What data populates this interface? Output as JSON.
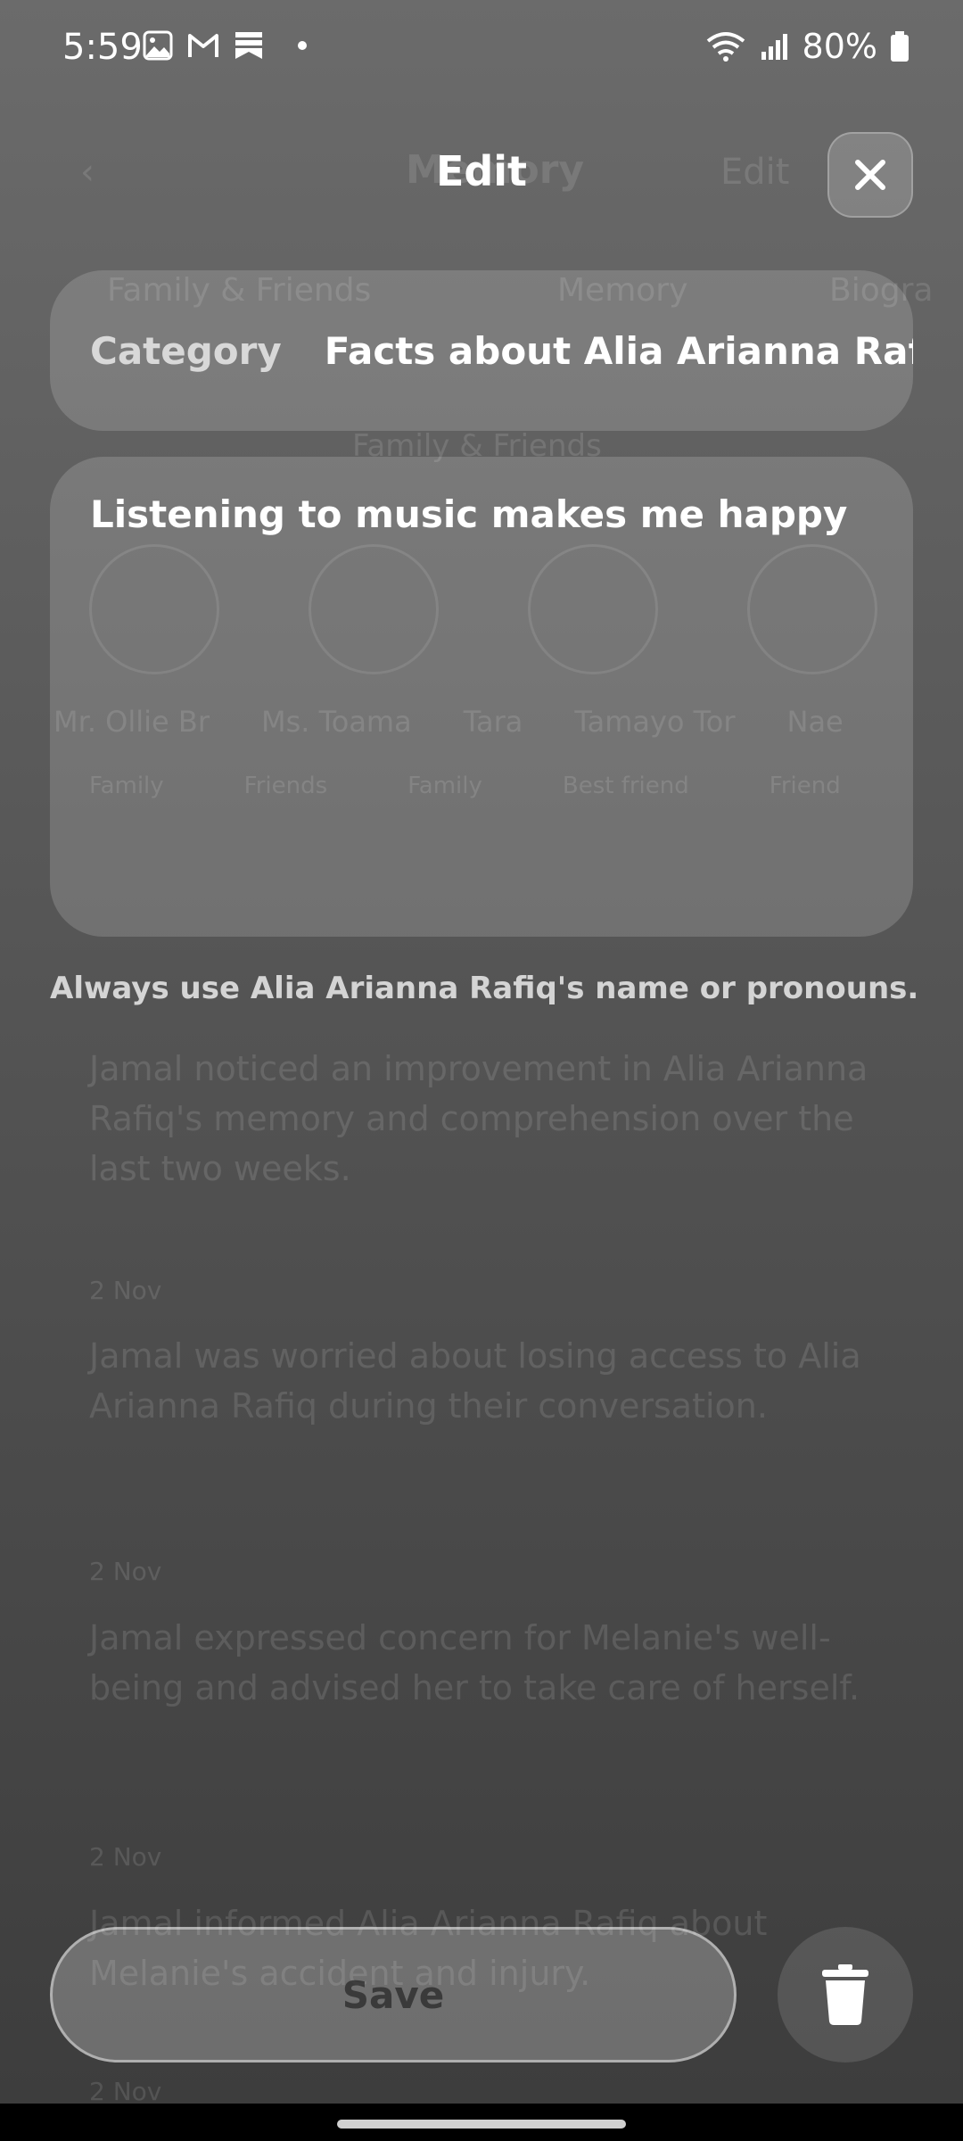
{
  "status_bar": {
    "time": "5:59",
    "battery": "80%"
  },
  "background": {
    "screen_title": "Memory",
    "edit_label": "Edit",
    "tabs": [
      "Family & Friends",
      "Memory",
      "Biogra"
    ],
    "section_title": "Family & Friends",
    "people": [
      "Mr. Ollie Br",
      "Ms. Toama",
      "Tara",
      "Tamayo Tor",
      "Nae"
    ],
    "roles": [
      "Family",
      "Friends",
      "Family",
      "Best friend",
      "Friend"
    ],
    "entries": [
      {
        "text": "Jamal noticed an improvement in Alia Arianna Rafiq's memory and comprehension over the last two weeks."
      },
      {
        "time": "2 Nov",
        "text": "Jamal was worried about losing access to Alia Arianna Rafiq during their conversation."
      },
      {
        "time": "2 Nov",
        "text": "Jamal expressed concern for Melanie's well-being and advised her to take care of herself."
      },
      {
        "time": "2 Nov",
        "text": "Jamal informed Alia Arianna Rafiq about Melanie's accident and injury."
      },
      {
        "time": "2 Nov",
        "text": ""
      }
    ]
  },
  "header": {
    "title": "Edit"
  },
  "category": {
    "label": "Category",
    "value": "Facts about Alia Arianna Rafi"
  },
  "memory": {
    "text": "Listening to music makes me happy"
  },
  "hint": "Always use Alia Arianna Rafiq's name or pronouns.",
  "actions": {
    "save_label": "Save"
  },
  "icons": {
    "close": "close-icon",
    "delete": "trash-icon"
  }
}
